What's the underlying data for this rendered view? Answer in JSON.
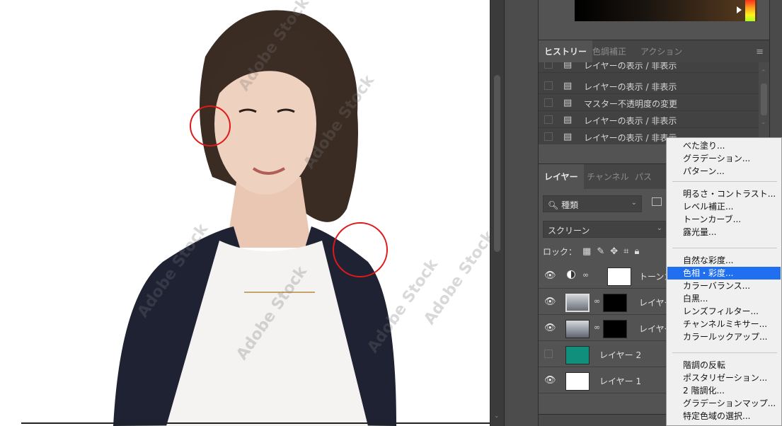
{
  "canvas": {
    "watermark": "Adobe Stock"
  },
  "history": {
    "tabs": [
      "ヒストリー",
      "色調補正",
      "アクション"
    ],
    "items": [
      "レイヤーの表示 / 非表示",
      "レイヤーの表示 / 非表示",
      "マスター不透明度の変更",
      "レイヤーの表示 / 非表示",
      "レイヤーの表示 / 非表示"
    ]
  },
  "layers": {
    "tabs": [
      "レイヤー",
      "チャンネル",
      "パス"
    ],
    "kind_filter": "種類",
    "blend_mode": "スクリーン",
    "lock_label": "ロック：",
    "rows": [
      {
        "name": "トーンカ",
        "visible": true
      },
      {
        "name": "レイヤー",
        "visible": true
      },
      {
        "name": "レイヤー",
        "visible": true
      },
      {
        "name": "レイヤー 2",
        "visible": false
      },
      {
        "name": "レイヤー 1",
        "visible": true
      }
    ]
  },
  "adjust_menu": {
    "groups": [
      [
        "べた塗り...",
        "グラデーション...",
        "パターン..."
      ],
      [
        "明るさ・コントラスト...",
        "レベル補正...",
        "トーンカーブ...",
        "露光量..."
      ],
      [
        "自然な彩度...",
        "色相・彩度...",
        "カラーバランス...",
        "白黒...",
        "レンズフィルター...",
        "チャンネルミキサー...",
        "カラールックアップ..."
      ],
      [
        "階調の反転",
        "ポスタリゼーション...",
        "2 階調化...",
        "グラデーションマップ...",
        "特定色域の選択..."
      ]
    ],
    "highlighted": "色相・彩度..."
  },
  "colors": {
    "menu_highlight": "#1f6ff0",
    "annotation_circle": "#e01a1a",
    "teal_layer": "#0f8f7c"
  }
}
